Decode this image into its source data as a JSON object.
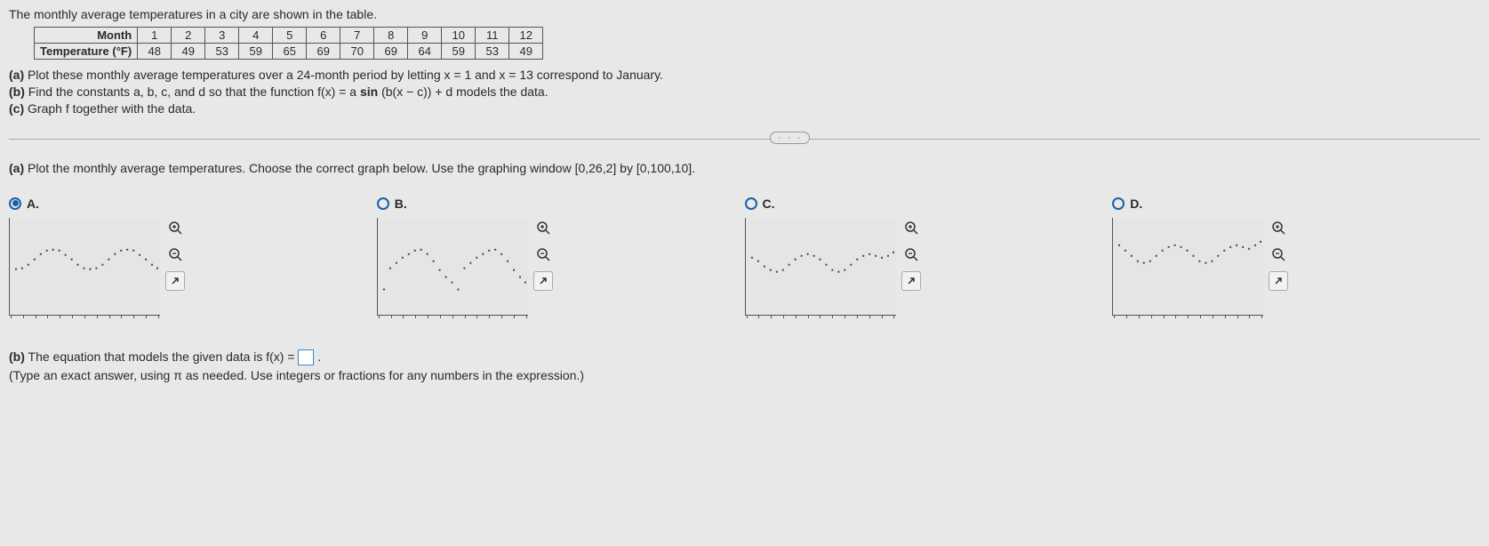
{
  "intro": "The monthly average temperatures in a city are shown in the table.",
  "table": {
    "row1_label": "Month",
    "row2_label": "Temperature (°F)",
    "months": [
      "1",
      "2",
      "3",
      "4",
      "5",
      "6",
      "7",
      "8",
      "9",
      "10",
      "11",
      "12"
    ],
    "temps": [
      "48",
      "49",
      "53",
      "59",
      "65",
      "69",
      "70",
      "69",
      "64",
      "59",
      "53",
      "49"
    ]
  },
  "prob_a_bold": "(a)",
  "prob_a_text": " Plot these monthly average temperatures over a 24-month period by letting x = 1 and x = 13 correspond to January.",
  "prob_b_bold": "(b)",
  "prob_b_text_1": " Find the constants a, b, c, and d so that the function f(x) = a ",
  "prob_b_sin": "sin",
  "prob_b_text_2": " (b(x − c)) + d models the data.",
  "prob_c_bold": "(c)",
  "prob_c_text": " Graph f together with the data.",
  "dots": "· · ·",
  "part_a_q_bold": "(a)",
  "part_a_q_text": " Plot the monthly average temperatures. Choose the correct graph below. Use the graphing window [0,26,2] by [0,100,10].",
  "options": {
    "A": "A.",
    "B": "B.",
    "C": "C.",
    "D": "D."
  },
  "icons": {
    "zoom_in": "⊕",
    "zoom_out": "⊖",
    "popout": "↗"
  },
  "part_b_line1_a": "(b)",
  "part_b_line1_b": " The equation that models the given data is f(x) = ",
  "part_b_line1_c": " .",
  "part_b_line2": "(Type an exact answer, using π as needed. Use integers or fractions for any numbers in the expression.)",
  "chart_data": {
    "type": "table",
    "title": "Monthly average temperatures",
    "x_label": "Month",
    "y_label": "Temperature (°F)",
    "categories": [
      1,
      2,
      3,
      4,
      5,
      6,
      7,
      8,
      9,
      10,
      11,
      12
    ],
    "values": [
      48,
      49,
      53,
      59,
      65,
      69,
      70,
      69,
      64,
      59,
      53,
      49
    ],
    "graphing_window": {
      "x": [
        0,
        26,
        2
      ],
      "y": [
        0,
        100,
        10
      ]
    }
  }
}
